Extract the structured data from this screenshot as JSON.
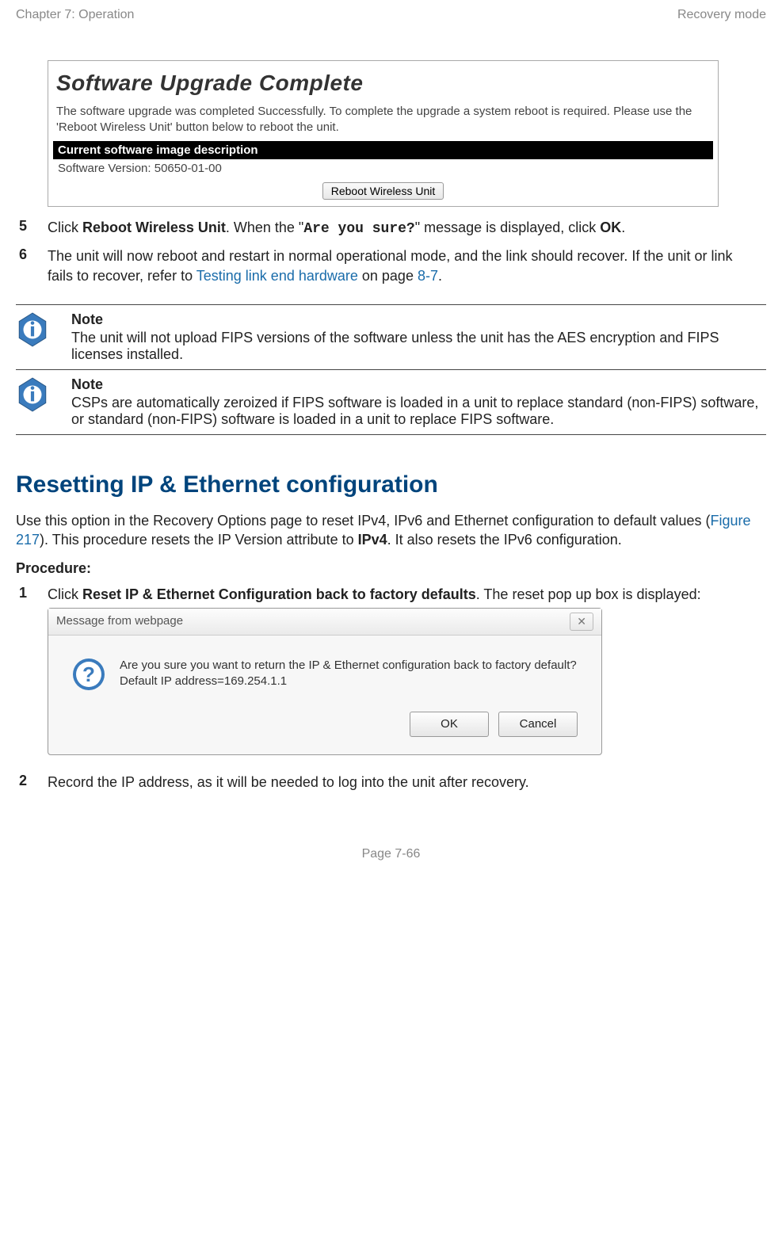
{
  "header": {
    "left": "Chapter 7:  Operation",
    "right": "Recovery mode"
  },
  "upgradeBox": {
    "title": "Software Upgrade Complete",
    "body": "The software upgrade was completed Successfully. To complete the upgrade a system reboot is required. Please use the 'Reboot Wireless Unit' button below to reboot the unit.",
    "subhead": "Current software image description",
    "version": "Software Version: 50650-01-00",
    "button": "Reboot Wireless Unit"
  },
  "steps_a": {
    "n5": "5",
    "t5_a": "Click ",
    "t5_b": "Reboot Wireless Unit",
    "t5_c": ". When the \"",
    "t5_d": "Are you sure?",
    "t5_e": "\" message is displayed, click ",
    "t5_f": "OK",
    "t5_g": ".",
    "n6": "6",
    "t6_a": "The unit will now reboot and restart in normal operational mode, and the link should recover. If the unit or link fails to recover, refer to ",
    "t6_link": "Testing link end hardware",
    "t6_b": " on page ",
    "t6_page": "8-7",
    "t6_c": "."
  },
  "notes": {
    "head": "Note",
    "n1": "The unit will not upload FIPS versions of the software unless the unit has the AES encryption and FIPS licenses installed.",
    "n2": "CSPs are automatically zeroized if FIPS software is loaded in a unit to replace standard (non-FIPS) software, or standard (non-FIPS) software is loaded in a unit to replace FIPS software."
  },
  "section2": {
    "title": "Resetting IP & Ethernet configuration",
    "intro_a": "Use this option in the Recovery Options page to reset IPv4, IPv6 and Ethernet configuration to default values (",
    "intro_link": "Figure 217",
    "intro_b": "). This procedure resets the IP Version attribute to ",
    "intro_bold": "IPv4",
    "intro_c": ". It also resets the IPv6 configuration.",
    "procedure": "Procedure:"
  },
  "steps_b": {
    "n1": "1",
    "t1_a": "Click ",
    "t1_b": "Reset IP & Ethernet Configuration back to factory defaults",
    "t1_c": ". The reset pop up box is displayed:",
    "n2": "2",
    "t2": "Record the IP address, as it will be needed to log into the unit after recovery."
  },
  "dialog": {
    "title": "Message from webpage",
    "close": "✕",
    "message": "Are you sure you want to return the IP & Ethernet configuration back to factory default? Default IP address=169.254.1.1",
    "ok": "OK",
    "cancel": "Cancel"
  },
  "footer": "Page 7-66"
}
